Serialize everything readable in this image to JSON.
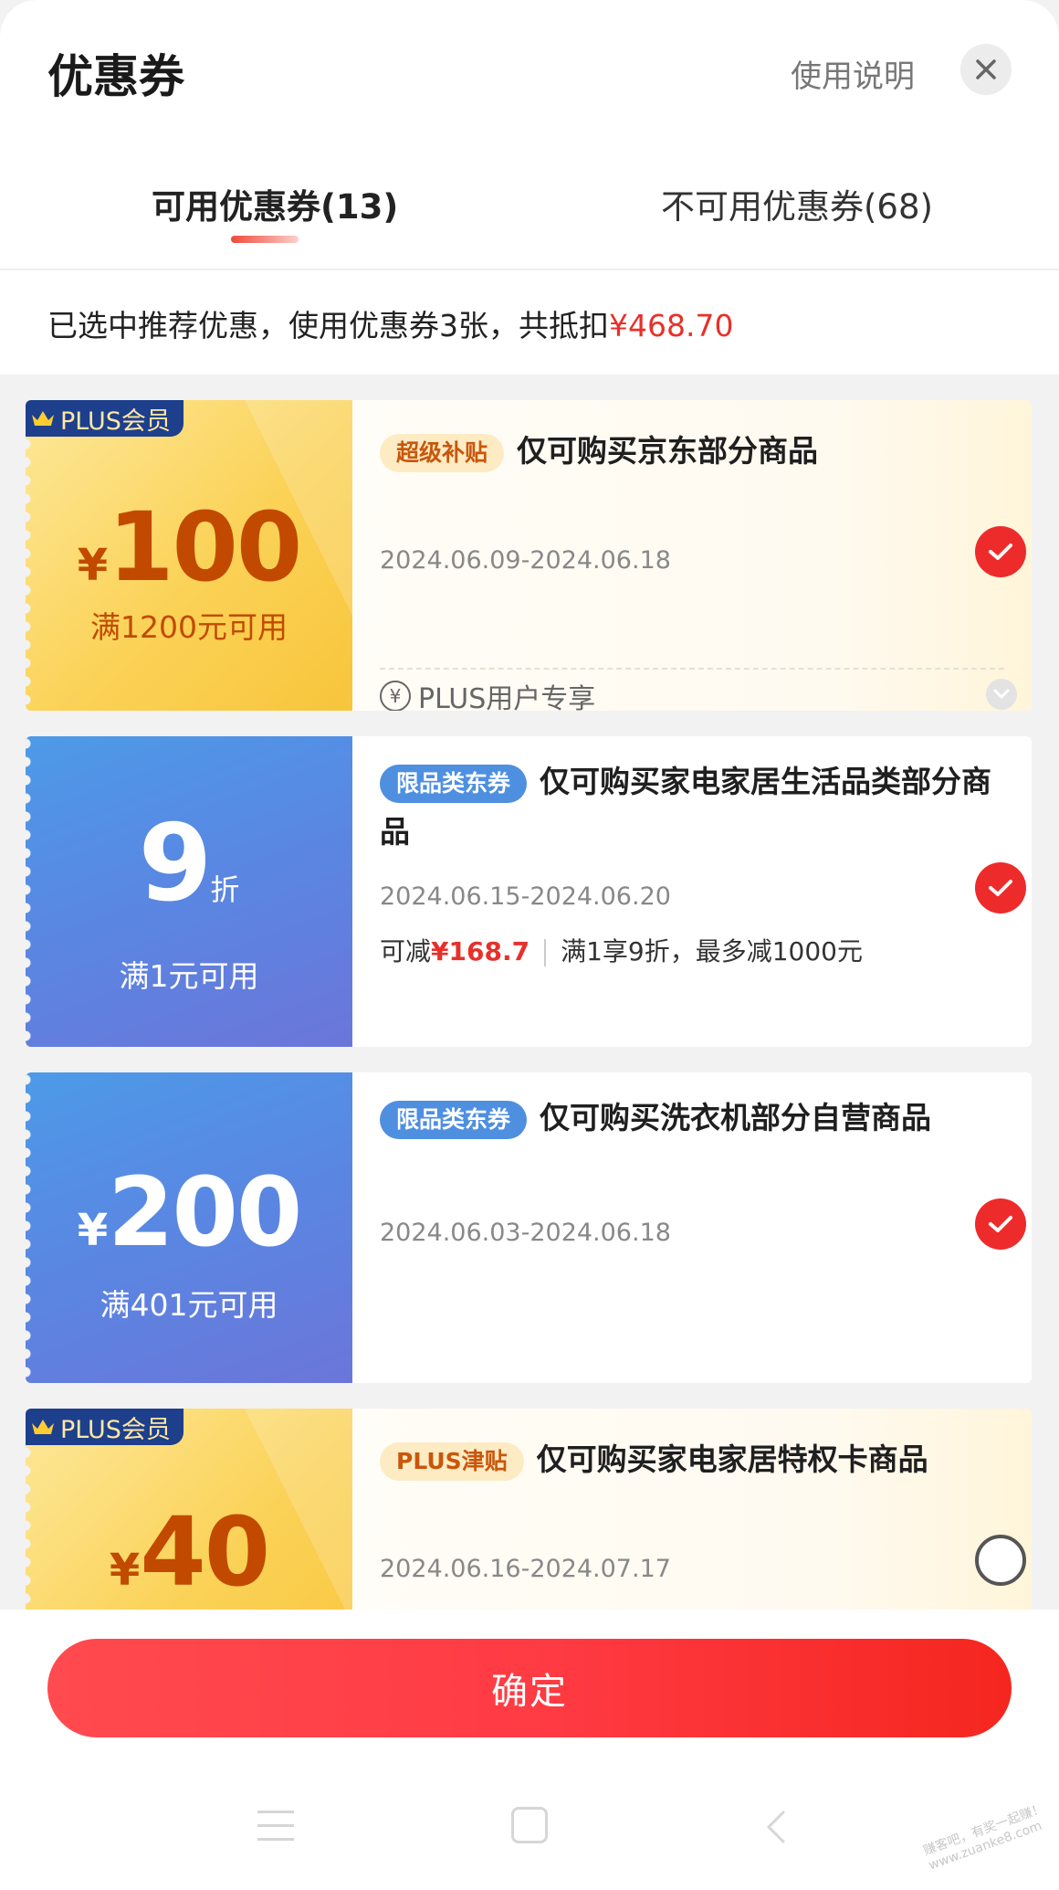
{
  "header": {
    "title": "优惠券",
    "help": "使用说明"
  },
  "tabs": {
    "available": "可用优惠券(13)",
    "unavailable": "不可用优惠券(68)"
  },
  "summary": {
    "prefix": "已选中推荐优惠，使用优惠券3张，共抵扣",
    "amount": "¥468.70"
  },
  "coupons": [
    {
      "badge": "PLUS会员",
      "currency": "¥",
      "value": "100",
      "condition": "满1200元可用",
      "tag": "超级补贴",
      "title": "仅可购买京东部分商品",
      "date": "2024.06.09-2024.06.18",
      "footer": "PLUS用户专享",
      "footer_icon": "¥",
      "checked": true
    },
    {
      "value": "9",
      "unit": "折",
      "condition": "满1元可用",
      "tag": "限品类东券",
      "title": "仅可购买家电家居生活品类部分商品",
      "date": "2024.06.15-2024.06.20",
      "extra_prefix": "可减",
      "extra_amount": "¥168.7",
      "extra_rule": "满1享9折，最多减1000元",
      "checked": true
    },
    {
      "currency": "¥",
      "value": "200",
      "condition": "满401元可用",
      "tag": "限品类东券",
      "title": "仅可购买洗衣机部分自营商品",
      "date": "2024.06.03-2024.06.18",
      "checked": true
    },
    {
      "badge": "PLUS会员",
      "currency": "¥",
      "value": "40",
      "tag": "PLUS津贴",
      "title": "仅可购买家电家居特权卡商品",
      "date": "2024.06.16-2024.07.17",
      "checked": false
    }
  ],
  "confirm": "确定",
  "watermark": "赚客吧，有奖一起赚！ www.zuanke8.com",
  "colors": {
    "accent": "#ee2b2b",
    "gold_text": "#c24a00",
    "plus_badge": "#1d3f8c"
  }
}
